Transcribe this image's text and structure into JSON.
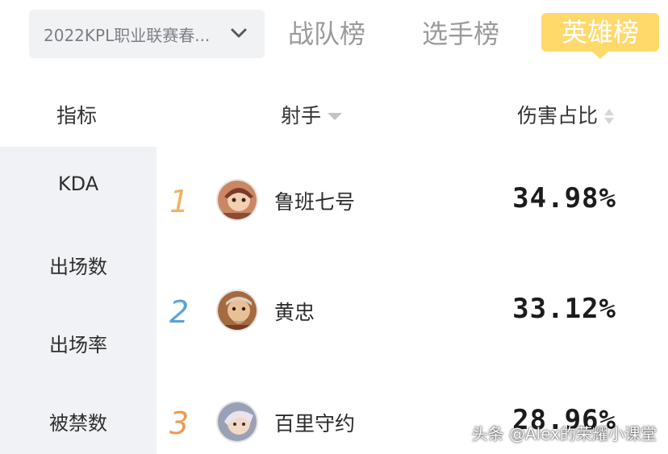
{
  "season_select": {
    "label": "2022KPL职业联赛春..."
  },
  "tabs": [
    {
      "label": "战队榜",
      "active": false
    },
    {
      "label": "选手榜",
      "active": false
    },
    {
      "label": "英雄榜",
      "active": true
    }
  ],
  "table_header": {
    "metric": "指标",
    "role": "射手",
    "share": "伤害占比"
  },
  "metric_menu": [
    "KDA",
    "出场数",
    "出场率",
    "被禁数"
  ],
  "rows": [
    {
      "rank": "1",
      "rank_color": "#f0b35a",
      "hero": "鲁班七号",
      "value": "34.98%"
    },
    {
      "rank": "2",
      "rank_color": "#5aa3d6",
      "hero": "黄忠",
      "value": "33.12%"
    },
    {
      "rank": "3",
      "rank_color": "#f09a4e",
      "hero": "百里守约",
      "value": "28.96%"
    }
  ],
  "watermark": "头条 @Alex的荣耀小课堂",
  "colors": {
    "accent": "#ffd96a",
    "menu_bg": "#f0f2f5",
    "select_bg": "#f1f2f4"
  }
}
